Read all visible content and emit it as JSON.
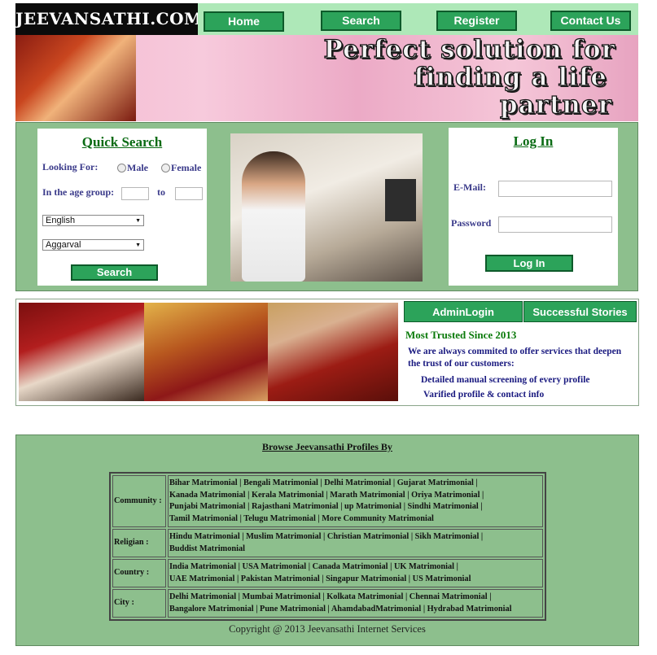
{
  "site": {
    "logo": "JEEVANSATHI.COM"
  },
  "nav": [
    {
      "label": "Home"
    },
    {
      "label": "Search"
    },
    {
      "label": "Register"
    },
    {
      "label": "Contact Us"
    }
  ],
  "banner": {
    "lines": [
      "Perfect solution for",
      "finding a life",
      "partner"
    ]
  },
  "quick_search": {
    "title": "Quick Search",
    "looking_for_label": "Looking For:",
    "gender_options": [
      "Male",
      "Female"
    ],
    "age_group_label": "In the age group:",
    "age_to_label": "to",
    "age_from_value": "",
    "age_to_value": "",
    "religion_selected": "English",
    "caste_selected": "Aggarval",
    "search_button": "Search"
  },
  "login": {
    "title": "Log In",
    "email_label": "E-Mail:",
    "password_label": "Password",
    "email_value": "",
    "password_value": "",
    "button": "Log In"
  },
  "tabs": [
    {
      "label": "AdminLogin"
    },
    {
      "label": "Successful Stories"
    }
  ],
  "trust": {
    "heading": "Most Trusted Since 2013",
    "text_line1": "We are always commited to offer services that deepen",
    "text_line2": "the trust of our customers:",
    "bullet1": "Detailed manual screening of every profile",
    "bullet2": "Varified profile & contact info"
  },
  "browse": {
    "title": "Browse Jeevansathi Profiles By",
    "rows": [
      {
        "category": "Community :",
        "lines": [
          "Bihar Matrimonial | Bengali Matrimonial | Delhi Matrimonial | Gujarat Matrimonial |",
          "Kanada Matrimonial | Kerala Matrimonial | Marath Matrimonial | Oriya Matrimonial |",
          "Punjabi Matrimonial | Rajasthani Matrimonial | up Matrimonial | Sindhi Matrimonial |",
          "Tamil Matrimonial | Telugu Matrimonial | More Community Matrimonial"
        ]
      },
      {
        "category": "Religian :",
        "lines": [
          "Hindu Matrimonial | Muslim Matrimonial | Christian Matrimonial | Sikh Matrimonial |",
          "Buddist Matrimonial"
        ]
      },
      {
        "category": "Country :",
        "lines": [
          "India Matrimonial | USA Matrimonial | Canada Matrimonial | UK Matrimonial |",
          "UAE Matrimonial | Pakistan Matrimonial | Singapur Matrimonial | US Matrimonial"
        ]
      },
      {
        "category": "City :",
        "lines": [
          "Delhi Matrimonial | Mumbai Matrimonial | Kolkata Matrimonial | Chennai Matrimonial |",
          "Bangalore Matrimonial | Pune Matrimonial | AhamdabadMatrimonial | Hydrabad Matrimonial"
        ]
      }
    ],
    "copyright": "Copyright @ 2013 Jeevansathi Internet Services"
  }
}
